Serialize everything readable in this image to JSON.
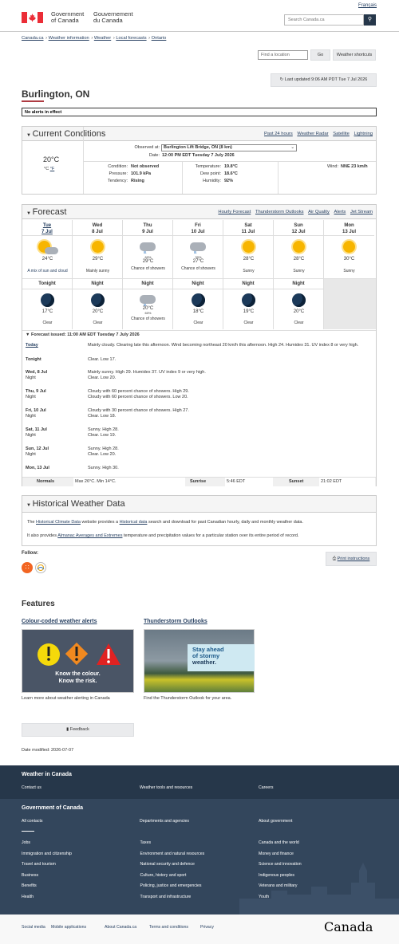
{
  "header": {
    "gov_en": [
      "Government",
      "of Canada"
    ],
    "gov_fr": [
      "Gouvernement",
      "du Canada"
    ],
    "lang": "Français",
    "search_placeholder": "Search Canada.ca",
    "search_icon": "search-icon"
  },
  "breadcrumb": [
    "Canada.ca",
    "Weather information",
    "Weather",
    "Local forecasts",
    "Ontario"
  ],
  "location": {
    "placeholder": "Find a location",
    "go": "Go",
    "shortcuts": "Weather shortcuts",
    "last_updated": "Last updated 9:06 AM PDT Tue 7 Jul 2026"
  },
  "city": "Burlington, ON",
  "alerts": "No alerts in effect",
  "current": {
    "title": "Current Conditions",
    "links": [
      "Past 24 hours",
      "Weather Radar",
      "Satellite",
      "Lightning"
    ],
    "temp": "20°C",
    "unit_c": "°C",
    "unit_f": "°F",
    "observed_label": "Observed at:",
    "station": "Burlington Lift Bridge, ON (8 km)",
    "date_label": "Date:",
    "date": "12:00 PM EDT Tuesday 7 July 2026",
    "condition_label": "Condition:",
    "condition": "Not observed",
    "pressure_label": "Pressure:",
    "pressure": "101.9 kPa",
    "tendency_label": "Tendency:",
    "tendency": "Rising",
    "temperature_label": "Temperature:",
    "temperature": "19.8°C",
    "dewpoint_label": "Dew point:",
    "dewpoint": "18.6°C",
    "humidity_label": "Humidity:",
    "humidity": "92%",
    "wind_label": "Wind:",
    "wind": "NNE 23 km/h"
  },
  "forecast": {
    "title": "Forecast",
    "links": [
      "Hourly Forecast",
      "Thunderstorm Outlooks",
      "Air Quality",
      "Alerts",
      "Jet Stream"
    ],
    "days": [
      {
        "d": "Tue",
        "n": "7 Jul",
        "t": "24°C",
        "desc": "A mix of sun and cloud",
        "icon": "sun-cloud-icon",
        "pop": ""
      },
      {
        "d": "Wed",
        "n": "8 Jul",
        "t": "29°C",
        "desc": "Mainly sunny",
        "icon": "sun-icon",
        "pop": ""
      },
      {
        "d": "Thu",
        "n": "9 Jul",
        "t": "29°C",
        "desc": "Chance of showers",
        "icon": "showers-icon",
        "pop": "60%"
      },
      {
        "d": "Fri",
        "n": "10 Jul",
        "t": "27°C",
        "desc": "Chance of showers",
        "icon": "showers-icon",
        "pop": "30%"
      },
      {
        "d": "Sat",
        "n": "11 Jul",
        "t": "28°C",
        "desc": "Sunny",
        "icon": "sun-icon",
        "pop": ""
      },
      {
        "d": "Sun",
        "n": "12 Jul",
        "t": "28°C",
        "desc": "Sunny",
        "icon": "sun-icon",
        "pop": ""
      },
      {
        "d": "Mon",
        "n": "13 Jul",
        "t": "30°C",
        "desc": "Sunny",
        "icon": "sun-icon",
        "pop": ""
      }
    ],
    "nights": [
      {
        "h": "Tonight",
        "t": "17°C",
        "desc": "Clear",
        "icon": "moon-icon",
        "pop": ""
      },
      {
        "h": "Night",
        "t": "20°C",
        "desc": "Clear",
        "icon": "moon-icon",
        "pop": ""
      },
      {
        "h": "Night",
        "t": "20°C",
        "desc": "Chance of showers",
        "icon": "showers-icon",
        "pop": "60%"
      },
      {
        "h": "Night",
        "t": "18°C",
        "desc": "Clear",
        "icon": "moon-icon",
        "pop": ""
      },
      {
        "h": "Night",
        "t": "19°C",
        "desc": "Clear",
        "icon": "moon-icon",
        "pop": ""
      },
      {
        "h": "Night",
        "t": "20°C",
        "desc": "Clear",
        "icon": "moon-icon",
        "pop": ""
      }
    ],
    "issued": "Forecast issued: 11:00 AM EDT Tuesday 7 July 2026",
    "text": [
      {
        "l": "Today",
        "l2": "",
        "a": "Mainly cloudy. Clearing late this afternoon. Wind becoming northeast 20 km/h this afternoon. High 24. Humidex 31. UV index 8 or very high.",
        "b": ""
      },
      {
        "l": "Tonight",
        "l2": "",
        "a": "Clear. Low 17.",
        "b": ""
      },
      {
        "l": "Wed, 8 Jul",
        "l2": "Night",
        "a": "Mainly sunny. High 29. Humidex 37. UV index 9 or very high.",
        "b": "Clear. Low 20."
      },
      {
        "l": "Thu, 9 Jul",
        "l2": "Night",
        "a": "Cloudy with 60 percent chance of showers. High 29.",
        "b": "Cloudy with 60 percent chance of showers. Low 20."
      },
      {
        "l": "Fri, 10 Jul",
        "l2": "Night",
        "a": "Cloudy with 30 percent chance of showers. High 27.",
        "b": "Clear. Low 18."
      },
      {
        "l": "Sat, 11 Jul",
        "l2": "Night",
        "a": "Sunny. High 28.",
        "b": "Clear. Low 19."
      },
      {
        "l": "Sun, 12 Jul",
        "l2": "Night",
        "a": "Sunny. High 28.",
        "b": "Clear. Low 20."
      },
      {
        "l": "Mon, 13 Jul",
        "l2": "",
        "a": "Sunny. High 30.",
        "b": ""
      }
    ],
    "normals_label": "Normals",
    "normals": "Max 26°C. Min 14°C.",
    "sunrise_label": "Sunrise",
    "sunrise": "5:46 EDT",
    "sunset_label": "Sunset",
    "sunset": "21:02 EDT"
  },
  "historical": {
    "title": "Historical Weather Data",
    "p1a": "The ",
    "p1link": "Historical Climate Data",
    "p1b": " website provides a ",
    "p1link2": "Historical data",
    "p1c": " search and download for past Canadian hourly, daily and monthly weather data.",
    "p2a": "It also provides ",
    "p2link": "Almanac Averages and Extremes",
    "p2b": " temperature and precipitation values for a particular station over its entire period of record."
  },
  "follow": "Follow:",
  "print": "Print instructions",
  "features": {
    "title": "Features",
    "items": [
      {
        "title": "Colour-coded weather alerts",
        "img_text": [
          "Know the colour.",
          "Know the risk."
        ],
        "caption": "Learn more about weather alerting in Canada"
      },
      {
        "title": "Thunderstorm Outlooks",
        "img_text": [
          "Stay ahead",
          "of stormy",
          "weather."
        ],
        "caption": "Find the Thunderstorm Outlook for your area."
      }
    ]
  },
  "feedback": "Feedback",
  "date_modified": "Date modified: 2026-07-07",
  "footer": {
    "wic": "Weather in Canada",
    "wic_links": [
      "Contact us",
      "Weather tools and resources",
      "Careers"
    ],
    "goc": "Government of Canada",
    "goc_links": [
      "All contacts",
      "Departments and agencies",
      "About government"
    ],
    "topics": [
      "Jobs",
      "Taxes",
      "Canada and the world",
      "Immigration and citizenship",
      "Environment and natural resources",
      "Money and finance",
      "Travel and tourism",
      "National security and defence",
      "Science and innovation",
      "Business",
      "Culture, history and sport",
      "Indigenous peoples",
      "Benefits",
      "Policing, justice and emergencies",
      "Veterans and military",
      "Health",
      "Transport and infrastructure",
      "Youth"
    ],
    "bottom": [
      "Social media",
      "Mobile applications",
      "About Canada.ca",
      "Terms and conditions",
      "Privacy"
    ],
    "wordmark": "Canada"
  }
}
